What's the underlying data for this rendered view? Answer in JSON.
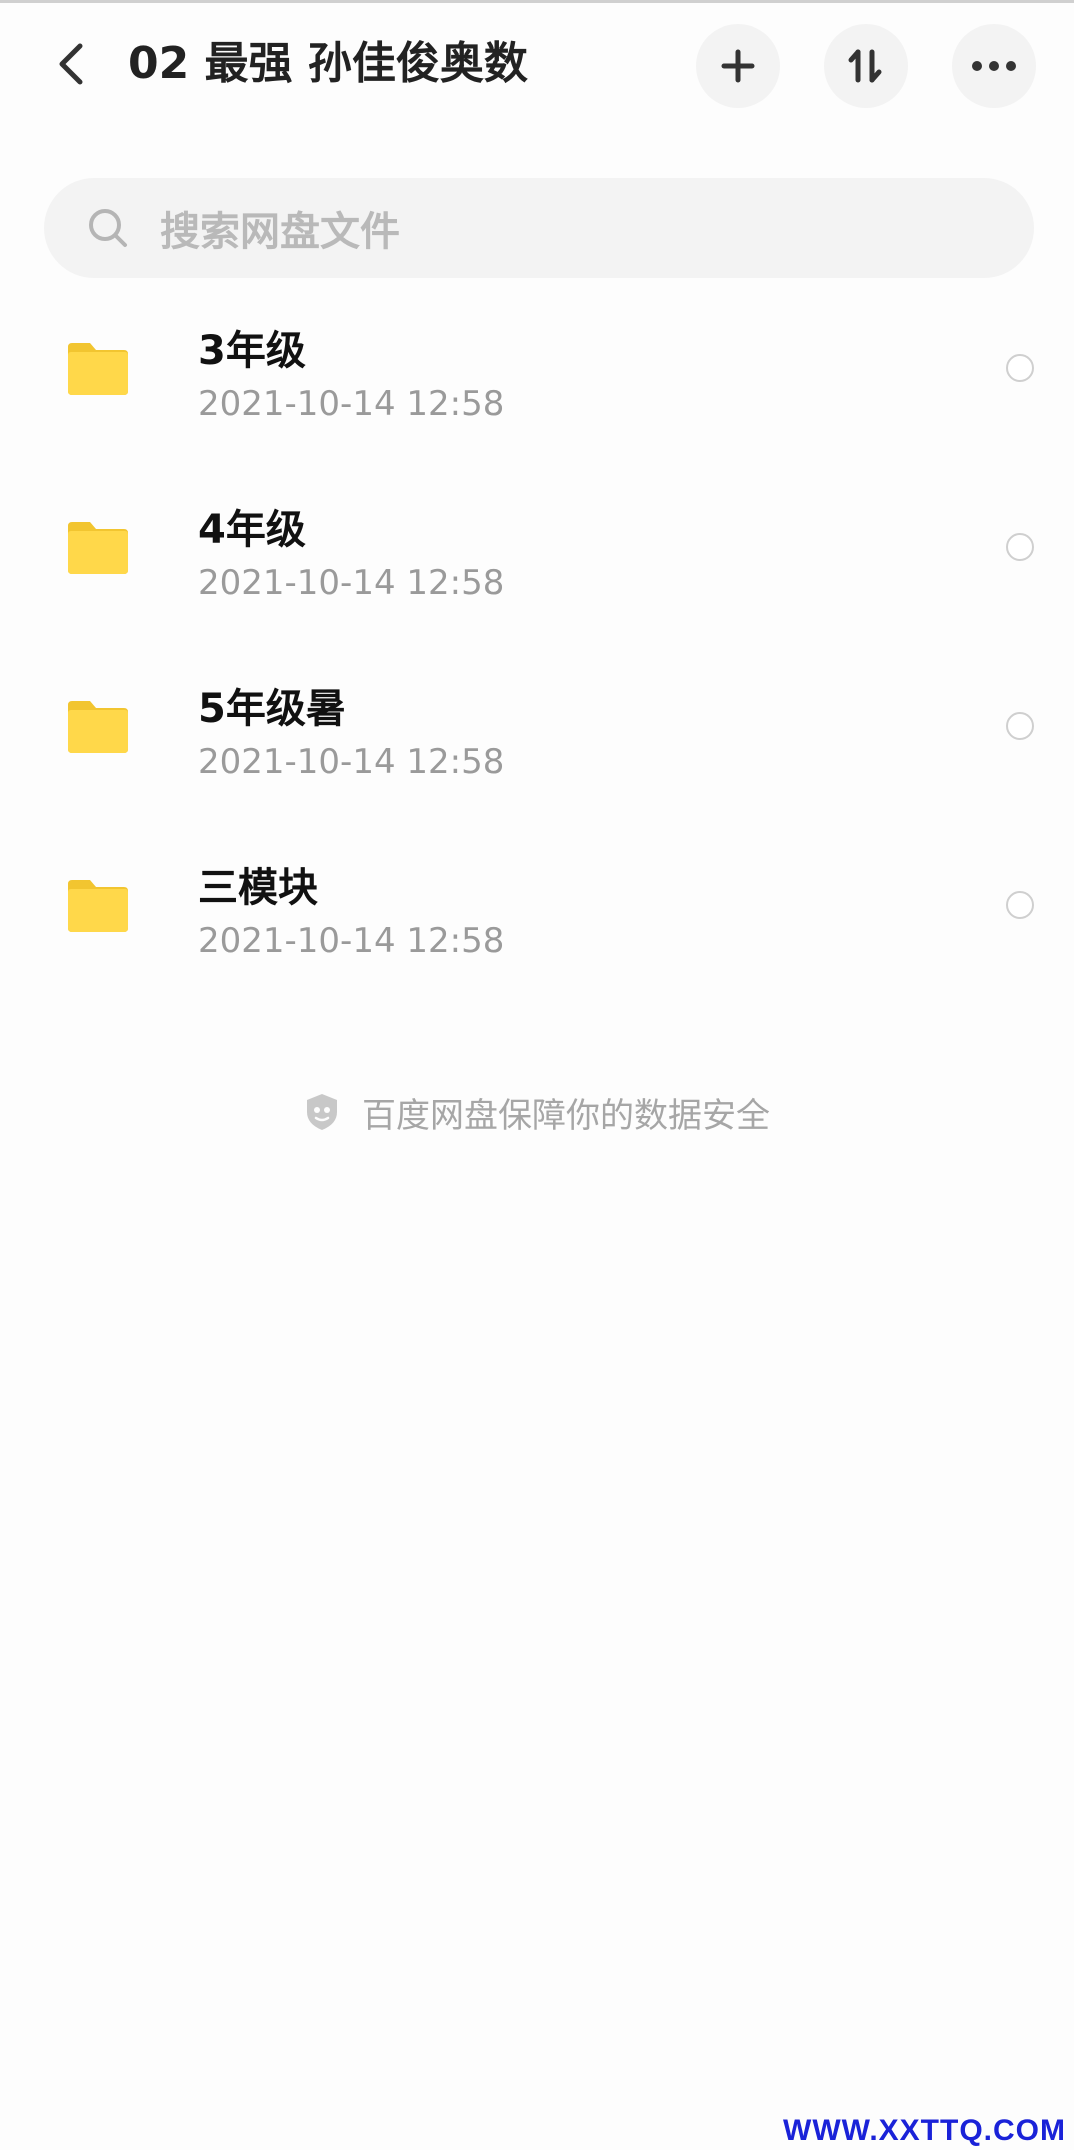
{
  "header": {
    "title": "02 最强 孙佳俊奥数",
    "back_icon": "chevron-left-icon",
    "add_icon": "plus-icon",
    "sort_icon": "sort-arrows-icon",
    "more_icon": "more-dots-icon"
  },
  "search": {
    "placeholder": "搜索网盘文件",
    "icon": "search-icon"
  },
  "files": [
    {
      "name": "3年级",
      "date": "2021-10-14  12:58",
      "icon": "folder-icon"
    },
    {
      "name": "4年级",
      "date": "2021-10-14  12:58",
      "icon": "folder-icon"
    },
    {
      "name": "5年级暑",
      "date": "2021-10-14  12:58",
      "icon": "folder-icon"
    },
    {
      "name": "三模块",
      "date": "2021-10-14  12:58",
      "icon": "folder-icon"
    }
  ],
  "footer": {
    "security_text": "百度网盘保障你的数据安全",
    "security_icon": "shield-icon"
  },
  "watermark": {
    "text": "WWW.XXTTQ.COM"
  },
  "colors": {
    "folder": "#FFD84A",
    "folder_tab": "#F2C530",
    "watermark": "#1A22D8",
    "background": "#FDFDFD"
  }
}
